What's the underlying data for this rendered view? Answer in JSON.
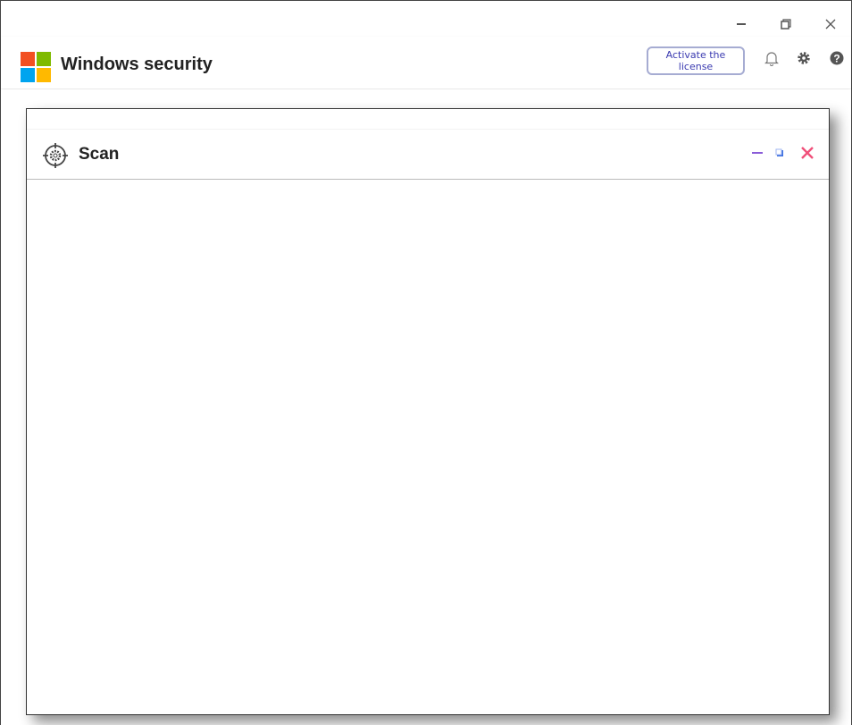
{
  "window": {
    "controls": {
      "minimize": "minimize",
      "restore": "restore",
      "close": "close"
    }
  },
  "header": {
    "title": "Windows security",
    "activate_label": "Activate the license",
    "icons": [
      "bell-icon",
      "gear-icon",
      "help-icon"
    ]
  },
  "dialog": {
    "title": "Scan",
    "icon": "scan-target-gear-icon",
    "controls": {
      "minimize_color": "#8a5cd8",
      "maximize_color": "#3b6fe0",
      "close_color": "#f0507a"
    }
  },
  "logo_colors": [
    "#f25022",
    "#7fba00",
    "#00a4ef",
    "#ffb900"
  ]
}
